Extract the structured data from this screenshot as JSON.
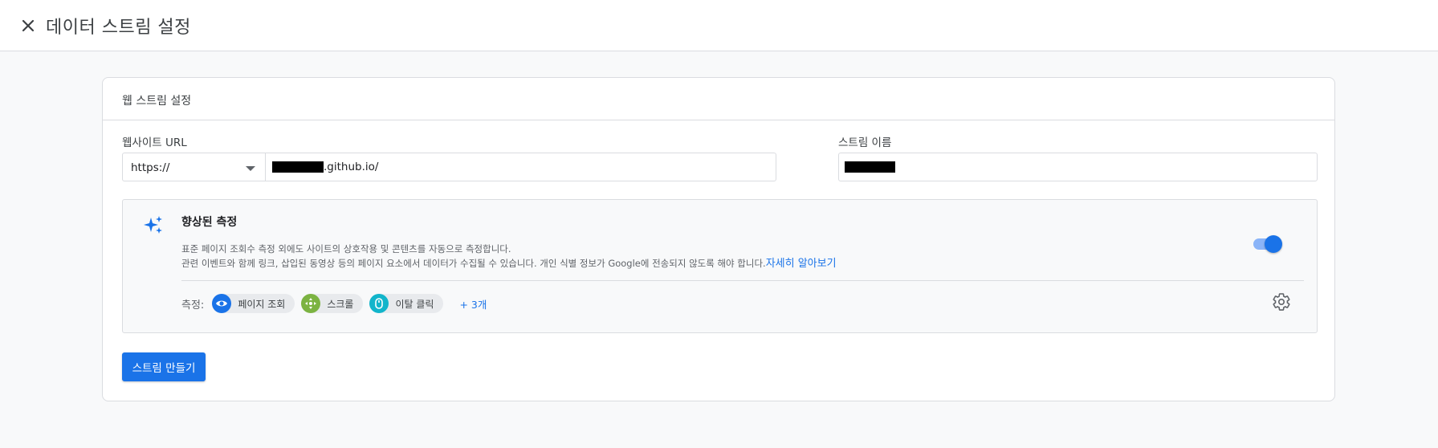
{
  "header": {
    "title": "데이터 스트림 설정",
    "close_icon": "close-icon"
  },
  "card": {
    "title": "웹 스트림 설정",
    "website_url_label": "웹사이트 URL",
    "protocol_value": "https://",
    "url_suffix": ".github.io/",
    "stream_name_label": "스트림 이름"
  },
  "enhanced_measurement": {
    "title": "향상된 측정",
    "description_line1": "표준 페이지 조회수 측정 외에도 사이트의 상호작용 및 콘텐츠를 자동으로 측정합니다.",
    "description_line2": "관련 이벤트와 함께 링크, 삽입된 동영상 등의 페이지 요소에서 데이터가 수집될 수 있습니다. 개인 식별 정보가 Google에 전송되지 않도록 해야 합니다.",
    "learn_more": "자세히 알아보기",
    "toggle_on": true,
    "measurement_label": "측정:",
    "chips": [
      {
        "label": "페이지 조회",
        "icon": "eye-icon",
        "color": "#1a73e8"
      },
      {
        "label": "스크롤",
        "icon": "scroll-crosshair-icon",
        "color": "#7cb342"
      },
      {
        "label": "이탈 클릭",
        "icon": "mouse-icon",
        "color": "#12b5cb"
      }
    ],
    "more": "+ 3개"
  },
  "actions": {
    "create_stream": "스트림 만들기"
  },
  "colors": {
    "primary": "#1a73e8",
    "border": "#dadce0",
    "background": "#f8f9fa"
  }
}
